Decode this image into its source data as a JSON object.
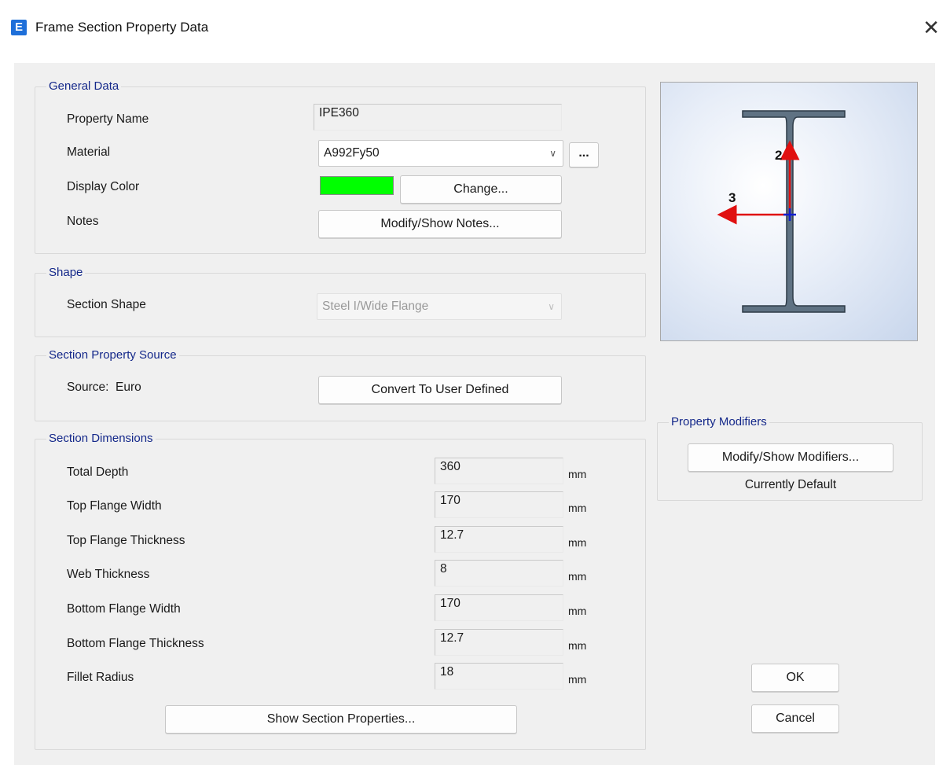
{
  "window": {
    "app_icon": "E",
    "title": "Frame Section Property Data",
    "close_glyph": "✕"
  },
  "general": {
    "label": "General Data",
    "property_name_label": "Property Name",
    "property_name_value": "IPE360",
    "material_label": "Material",
    "material_value": "A992Fy50",
    "material_more": "...",
    "display_color_label": "Display Color",
    "display_color_hex": "#00FF00",
    "change_button": "Change...",
    "notes_label": "Notes",
    "notes_button": "Modify/Show Notes..."
  },
  "shape": {
    "label": "Shape",
    "section_shape_label": "Section Shape",
    "section_shape_value": "Steel I/Wide Flange"
  },
  "source": {
    "label": "Section Property Source",
    "source_text": "Source:  Euro",
    "convert_button": "Convert To User Defined"
  },
  "dimensions": {
    "label": "Section Dimensions",
    "rows": [
      {
        "label": "Total Depth",
        "value": "360",
        "unit": "mm"
      },
      {
        "label": "Top Flange Width",
        "value": "170",
        "unit": "mm"
      },
      {
        "label": "Top Flange Thickness",
        "value": "12.7",
        "unit": "mm"
      },
      {
        "label": "Web Thickness",
        "value": "8",
        "unit": "mm"
      },
      {
        "label": "Bottom Flange Width",
        "value": "170",
        "unit": "mm"
      },
      {
        "label": "Bottom Flange Thickness",
        "value": "12.7",
        "unit": "mm"
      },
      {
        "label": "Fillet Radius",
        "value": "18",
        "unit": "mm"
      }
    ],
    "show_properties_button": "Show Section Properties..."
  },
  "preview": {
    "axis_2_label": "2",
    "axis_3_label": "3",
    "section_color": "#5f7283",
    "axis_color": "#e01010"
  },
  "modifiers": {
    "label": "Property Modifiers",
    "button": "Modify/Show Modifiers...",
    "status": "Currently Default"
  },
  "actions": {
    "ok": "OK",
    "cancel": "Cancel"
  }
}
